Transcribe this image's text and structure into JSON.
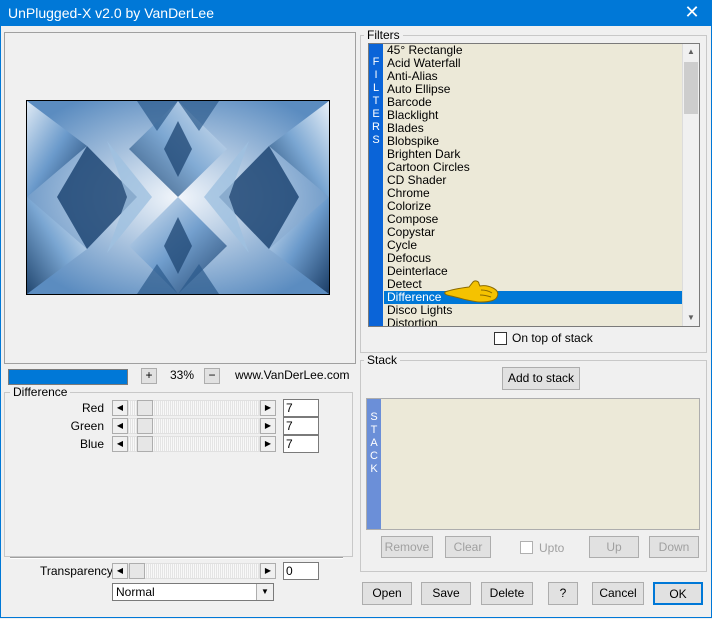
{
  "window": {
    "title": "UnPlugged-X v2.0 by VanDerLee",
    "close_glyph": "✕"
  },
  "filters": {
    "group_label": "Filters",
    "banner": [
      "F",
      "I",
      "L",
      "T",
      "E",
      "R",
      "S"
    ],
    "items": [
      "45° Rectangle",
      "Acid Waterfall",
      "Anti-Alias",
      "Auto Ellipse",
      "Barcode",
      "Blacklight",
      "Blades",
      "Blobspike",
      "Brighten Dark",
      "Cartoon Circles",
      "CD Shader",
      "Chrome",
      "Colorize",
      "Compose",
      "Copystar",
      "Cycle",
      "Defocus",
      "Deinterlace",
      "Detect",
      "Difference",
      "Disco Lights",
      "Distortion"
    ],
    "selected": "Difference",
    "on_top_label": "On top of stack"
  },
  "preview": {
    "progress": 1.0,
    "zoom_minus": "−",
    "zoom_plus": "+",
    "zoom": "33%",
    "website": "www.VanDerLee.com"
  },
  "difference": {
    "group_label": "Difference",
    "sliders": [
      {
        "label": "Red",
        "value": "7"
      },
      {
        "label": "Green",
        "value": "7"
      },
      {
        "label": "Blue",
        "value": "7"
      }
    ]
  },
  "transparency": {
    "label": "Transparency",
    "value": "0",
    "mode": "Normal"
  },
  "stack": {
    "group_label": "Stack",
    "add_button": "Add to stack",
    "banner": [
      "S",
      "T",
      "A",
      "C",
      "K"
    ],
    "remove": "Remove",
    "clear": "Clear",
    "upto": "Upto",
    "up": "Up",
    "down": "Down"
  },
  "footer": {
    "open": "Open",
    "save": "Save",
    "delete": "Delete",
    "help": "?",
    "cancel": "Cancel",
    "ok": "OK"
  },
  "colors": {
    "accent": "#0078d7",
    "banner": "#0a64d8",
    "list_bg": "#ece9d8",
    "stack_banner": "#6b8fd8"
  },
  "icons": {
    "list_cursor": "pointing-hand-icon"
  }
}
